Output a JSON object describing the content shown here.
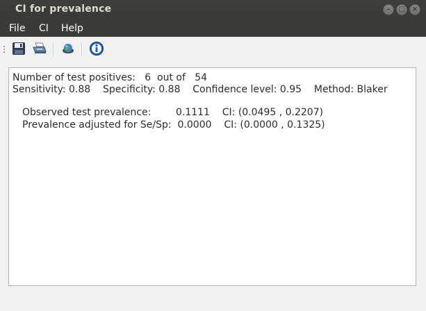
{
  "window": {
    "title": "CI for prevalence",
    "controls": [
      "minimize",
      "maximize",
      "close"
    ]
  },
  "menu": [
    "File",
    "CI",
    "Help"
  ],
  "toolbar": {
    "buttons": [
      "save-icon",
      "print-icon",
      "globe-icon",
      "info-icon"
    ]
  },
  "output": {
    "lines": [
      "Number of test positives:   6  out of   54",
      "Sensitivity: 0.88    Specificity: 0.88    Confidence level: 0.95    Method: Blaker",
      "Observed test prevalence:        0.1111    CI: (0.0495 , 0.2207)",
      "Prevalence adjusted for Se/Sp:  0.0000    CI: (0.0000 , 0.1325)"
    ]
  }
}
